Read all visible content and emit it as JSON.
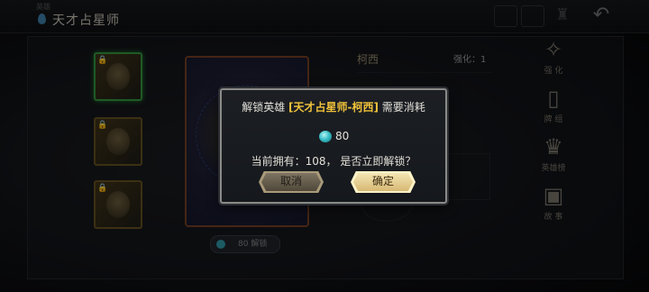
{
  "header": {
    "title": "天才占星师",
    "tiny_label": "英雄"
  },
  "hero_list": [
    {
      "locked": true,
      "active": true
    },
    {
      "locked": true,
      "active": false
    },
    {
      "locked": true,
      "active": false
    }
  ],
  "detail": {
    "name": "柯西",
    "enhance_label": "强化：1"
  },
  "unlock_pill": {
    "cost": "80",
    "label": "解锁"
  },
  "side_menu": [
    {
      "label": "强 化",
      "icon": "enhance-icon"
    },
    {
      "label": "牌 组",
      "icon": "deck-icon"
    },
    {
      "label": "英雄榜",
      "icon": "ranking-icon"
    },
    {
      "label": "故 事",
      "icon": "story-icon"
    }
  ],
  "dialog": {
    "prefix": "解锁英雄 ",
    "hero_name": "[天才占星师-柯西]",
    "suffix": " 需要消耗",
    "cost": "80",
    "line2": "当前拥有：108， 是否立即解锁？",
    "cancel_label": "取消",
    "confirm_label": "确定"
  },
  "colors": {
    "highlight": "#f0c23a",
    "gem": "#3ac0c8",
    "confirm_button": "#f4e6b4",
    "cancel_button": "#7e7462"
  }
}
